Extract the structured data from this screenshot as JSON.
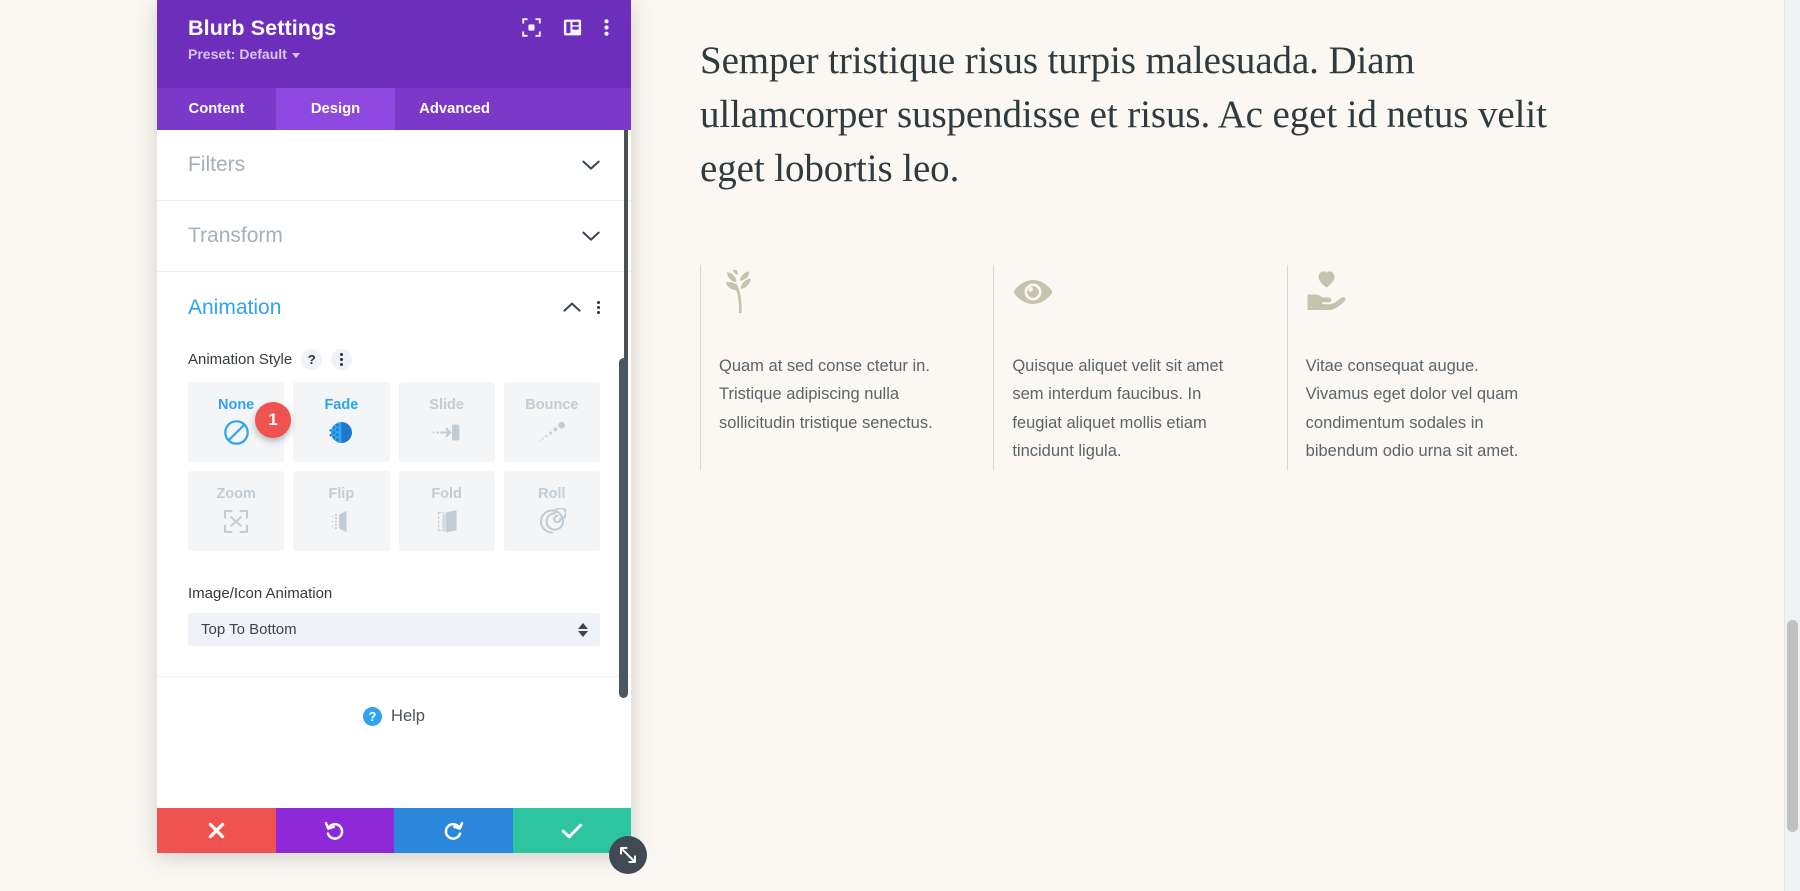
{
  "page": {
    "background_color": "#fbf8f3",
    "hero_heading": "Semper tristique risus turpis malesuada. Diam ullamcorper suspendisse et risus. Ac eget id netus velit eget lobortis leo.",
    "blurbs": [
      {
        "icon": "leaf-branch-icon",
        "text": "Quam at sed conse ctetur in. Tristique adipiscing nulla sollicitudin tristique senectus."
      },
      {
        "icon": "eye-icon",
        "text": "Quisque aliquet velit sit amet sem interdum faucibus. In feugiat aliquet mollis etiam tincidunt ligula."
      },
      {
        "icon": "hand-holding-heart-icon",
        "text": "Vitae consequat augue. Vivamus eget dolor vel quam condimentum sodales in bibendum odio urna sit amet."
      }
    ]
  },
  "panel": {
    "title": "Blurb Settings",
    "preset_label": "Preset: Default",
    "header_color": "#6d2fbb",
    "tabs_bar_color": "#7a39c9",
    "active_tab_color": "#8e4ae0",
    "header_icons": [
      {
        "name": "focus-target-icon"
      },
      {
        "name": "layout-panel-icon"
      },
      {
        "name": "more-options-icon"
      }
    ],
    "tabs": [
      {
        "label": "Content",
        "active": false
      },
      {
        "label": "Design",
        "active": true
      },
      {
        "label": "Advanced",
        "active": false
      }
    ],
    "sections": [
      {
        "label": "Filters",
        "open": false
      },
      {
        "label": "Transform",
        "open": false
      },
      {
        "label": "Animation",
        "open": true
      }
    ],
    "animation": {
      "section_label": "Animation",
      "accent_color": "#2ea3f2",
      "style_field_label": "Animation Style",
      "help_tooltip_glyph": "?",
      "styles": [
        {
          "label": "None",
          "icon": "no-entry-icon",
          "enabled": true
        },
        {
          "label": "Fade",
          "icon": "fade-dots-icon",
          "enabled": true
        },
        {
          "label": "Slide",
          "icon": "slide-arrow-icon",
          "enabled": false
        },
        {
          "label": "Bounce",
          "icon": "bounce-dots-icon",
          "enabled": false
        },
        {
          "label": "Zoom",
          "icon": "zoom-expand-icon",
          "enabled": false
        },
        {
          "label": "Flip",
          "icon": "flip-card-icon",
          "enabled": false
        },
        {
          "label": "Fold",
          "icon": "fold-page-icon",
          "enabled": false
        },
        {
          "label": "Roll",
          "icon": "roll-spiral-icon",
          "enabled": false
        }
      ],
      "marker_badge": "1",
      "marker_badge_color": "#ef5350",
      "image_icon_animation_label": "Image/Icon Animation",
      "image_icon_animation_value": "Top To Bottom"
    },
    "help": {
      "label": "Help",
      "icon": "help-circle-icon",
      "glyph": "?"
    },
    "footer": [
      {
        "name": "cancel-button",
        "icon": "close-x-icon",
        "color": "#ef5350"
      },
      {
        "name": "undo-button",
        "icon": "undo-arrow-icon",
        "color": "#8e29d8"
      },
      {
        "name": "redo-button",
        "icon": "redo-arrow-icon",
        "color": "#2b87da"
      },
      {
        "name": "save-button",
        "icon": "checkmark-icon",
        "color": "#2dc4a0"
      }
    ],
    "resize_handle_icon": "resize-diagonal-icon"
  }
}
